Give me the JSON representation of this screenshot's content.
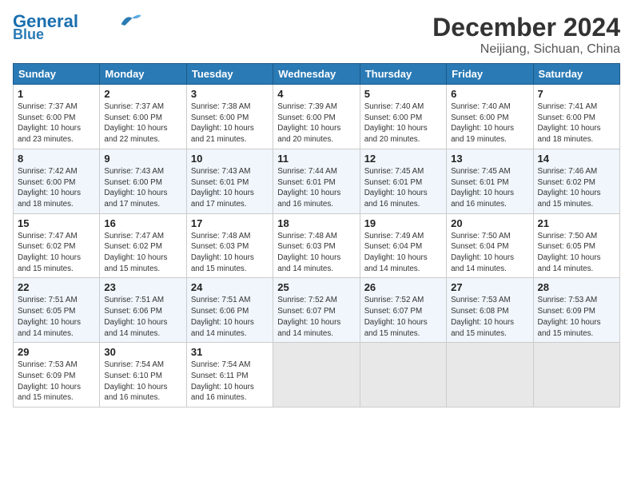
{
  "header": {
    "logo_line1": "General",
    "logo_line2": "Blue",
    "month": "December 2024",
    "location": "Neijiang, Sichuan, China"
  },
  "weekdays": [
    "Sunday",
    "Monday",
    "Tuesday",
    "Wednesday",
    "Thursday",
    "Friday",
    "Saturday"
  ],
  "weeks": [
    [
      {
        "day": "1",
        "info": "Sunrise: 7:37 AM\nSunset: 6:00 PM\nDaylight: 10 hours\nand 23 minutes."
      },
      {
        "day": "2",
        "info": "Sunrise: 7:37 AM\nSunset: 6:00 PM\nDaylight: 10 hours\nand 22 minutes."
      },
      {
        "day": "3",
        "info": "Sunrise: 7:38 AM\nSunset: 6:00 PM\nDaylight: 10 hours\nand 21 minutes."
      },
      {
        "day": "4",
        "info": "Sunrise: 7:39 AM\nSunset: 6:00 PM\nDaylight: 10 hours\nand 20 minutes."
      },
      {
        "day": "5",
        "info": "Sunrise: 7:40 AM\nSunset: 6:00 PM\nDaylight: 10 hours\nand 20 minutes."
      },
      {
        "day": "6",
        "info": "Sunrise: 7:40 AM\nSunset: 6:00 PM\nDaylight: 10 hours\nand 19 minutes."
      },
      {
        "day": "7",
        "info": "Sunrise: 7:41 AM\nSunset: 6:00 PM\nDaylight: 10 hours\nand 18 minutes."
      }
    ],
    [
      {
        "day": "8",
        "info": "Sunrise: 7:42 AM\nSunset: 6:00 PM\nDaylight: 10 hours\nand 18 minutes."
      },
      {
        "day": "9",
        "info": "Sunrise: 7:43 AM\nSunset: 6:00 PM\nDaylight: 10 hours\nand 17 minutes."
      },
      {
        "day": "10",
        "info": "Sunrise: 7:43 AM\nSunset: 6:01 PM\nDaylight: 10 hours\nand 17 minutes."
      },
      {
        "day": "11",
        "info": "Sunrise: 7:44 AM\nSunset: 6:01 PM\nDaylight: 10 hours\nand 16 minutes."
      },
      {
        "day": "12",
        "info": "Sunrise: 7:45 AM\nSunset: 6:01 PM\nDaylight: 10 hours\nand 16 minutes."
      },
      {
        "day": "13",
        "info": "Sunrise: 7:45 AM\nSunset: 6:01 PM\nDaylight: 10 hours\nand 16 minutes."
      },
      {
        "day": "14",
        "info": "Sunrise: 7:46 AM\nSunset: 6:02 PM\nDaylight: 10 hours\nand 15 minutes."
      }
    ],
    [
      {
        "day": "15",
        "info": "Sunrise: 7:47 AM\nSunset: 6:02 PM\nDaylight: 10 hours\nand 15 minutes."
      },
      {
        "day": "16",
        "info": "Sunrise: 7:47 AM\nSunset: 6:02 PM\nDaylight: 10 hours\nand 15 minutes."
      },
      {
        "day": "17",
        "info": "Sunrise: 7:48 AM\nSunset: 6:03 PM\nDaylight: 10 hours\nand 15 minutes."
      },
      {
        "day": "18",
        "info": "Sunrise: 7:48 AM\nSunset: 6:03 PM\nDaylight: 10 hours\nand 14 minutes."
      },
      {
        "day": "19",
        "info": "Sunrise: 7:49 AM\nSunset: 6:04 PM\nDaylight: 10 hours\nand 14 minutes."
      },
      {
        "day": "20",
        "info": "Sunrise: 7:50 AM\nSunset: 6:04 PM\nDaylight: 10 hours\nand 14 minutes."
      },
      {
        "day": "21",
        "info": "Sunrise: 7:50 AM\nSunset: 6:05 PM\nDaylight: 10 hours\nand 14 minutes."
      }
    ],
    [
      {
        "day": "22",
        "info": "Sunrise: 7:51 AM\nSunset: 6:05 PM\nDaylight: 10 hours\nand 14 minutes."
      },
      {
        "day": "23",
        "info": "Sunrise: 7:51 AM\nSunset: 6:06 PM\nDaylight: 10 hours\nand 14 minutes."
      },
      {
        "day": "24",
        "info": "Sunrise: 7:51 AM\nSunset: 6:06 PM\nDaylight: 10 hours\nand 14 minutes."
      },
      {
        "day": "25",
        "info": "Sunrise: 7:52 AM\nSunset: 6:07 PM\nDaylight: 10 hours\nand 14 minutes."
      },
      {
        "day": "26",
        "info": "Sunrise: 7:52 AM\nSunset: 6:07 PM\nDaylight: 10 hours\nand 15 minutes."
      },
      {
        "day": "27",
        "info": "Sunrise: 7:53 AM\nSunset: 6:08 PM\nDaylight: 10 hours\nand 15 minutes."
      },
      {
        "day": "28",
        "info": "Sunrise: 7:53 AM\nSunset: 6:09 PM\nDaylight: 10 hours\nand 15 minutes."
      }
    ],
    [
      {
        "day": "29",
        "info": "Sunrise: 7:53 AM\nSunset: 6:09 PM\nDaylight: 10 hours\nand 15 minutes."
      },
      {
        "day": "30",
        "info": "Sunrise: 7:54 AM\nSunset: 6:10 PM\nDaylight: 10 hours\nand 16 minutes."
      },
      {
        "day": "31",
        "info": "Sunrise: 7:54 AM\nSunset: 6:11 PM\nDaylight: 10 hours\nand 16 minutes."
      },
      {
        "day": "",
        "info": ""
      },
      {
        "day": "",
        "info": ""
      },
      {
        "day": "",
        "info": ""
      },
      {
        "day": "",
        "info": ""
      }
    ]
  ]
}
